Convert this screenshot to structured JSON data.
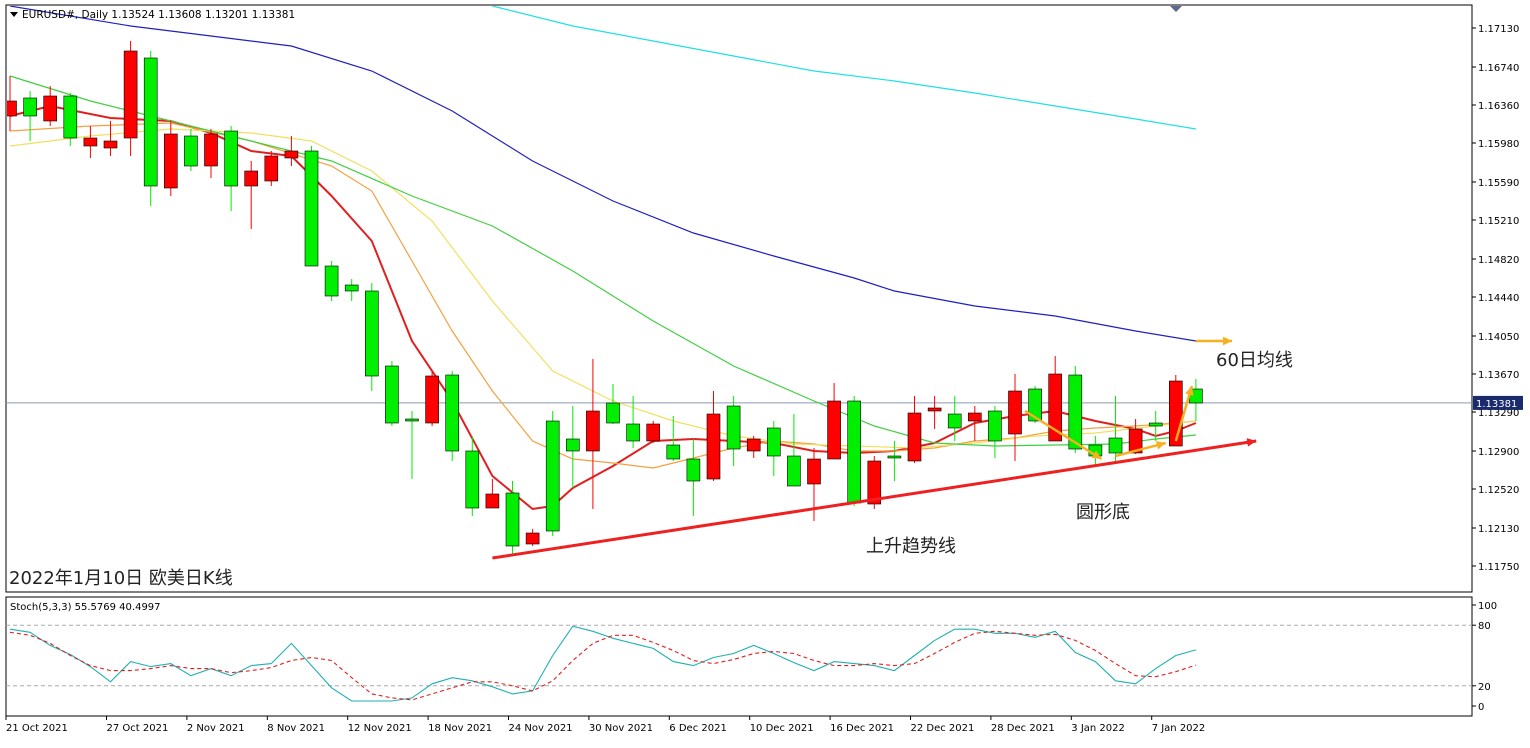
{
  "header": {
    "symbol_line": "EURUSD#, Daily  1.13524 1.13608 1.13201 1.13381"
  },
  "stoch_header": "Stoch(5,3,3) 55.5769 40.4997",
  "current_price_label": "1.13381",
  "annotations": {
    "caption": "2022年1月10日 欧美日K线",
    "ma60": "60日均线",
    "trendline": "上升趋势线",
    "rounding_bottom": "圆形底"
  },
  "colors": {
    "up_candle": "#00ee00",
    "down_candle": "#ff0000",
    "ma5": "#e02020",
    "ma10": "#f5a040",
    "ma20": "#f0e060",
    "ma30": "#40d040",
    "ma60": "#2020c0",
    "ma120": "#20e0e0",
    "stoch_main": "#20b0b0",
    "stoch_signal": "#e02020",
    "arrow_orange": "#f8b020",
    "trend_red": "#ee2020"
  },
  "chart_data": [
    {
      "type": "candlestick",
      "title": "EURUSD#, Daily",
      "ylim": [
        1.1155,
        1.1735
      ],
      "y_ticks": [
        "1.17130",
        "1.16740",
        "1.16360",
        "1.15980",
        "1.15590",
        "1.15210",
        "1.14820",
        "1.14440",
        "1.14050",
        "1.13670",
        "1.13290",
        "1.12900",
        "1.12520",
        "1.12130",
        "1.11750"
      ],
      "x_tick_labels": [
        "21 Oct 2021",
        "27 Oct 2021",
        "2 Nov 2021",
        "8 Nov 2021",
        "12 Nov 2021",
        "18 Nov 2021",
        "24 Nov 2021",
        "30 Nov 2021",
        "6 Dec 2021",
        "10 Dec 2021",
        "16 Dec 2021",
        "22 Dec 2021",
        "28 Dec 2021",
        "3 Jan 2022",
        "7 Jan 2022"
      ],
      "x_tick_bar_index": [
        0,
        5,
        9,
        13,
        17,
        21,
        25,
        29,
        33,
        37,
        41,
        45,
        49,
        53,
        57
      ],
      "current_price": 1.13381,
      "ohlc": [
        [
          1.164,
          1.1665,
          1.161,
          1.1625
        ],
        [
          1.1625,
          1.165,
          1.16,
          1.1643
        ],
        [
          1.1645,
          1.1655,
          1.1615,
          1.162
        ],
        [
          1.1603,
          1.1648,
          1.1595,
          1.1645
        ],
        [
          1.1603,
          1.1615,
          1.1583,
          1.1595
        ],
        [
          1.16,
          1.162,
          1.1585,
          1.1593
        ],
        [
          1.169,
          1.17,
          1.1585,
          1.1603
        ],
        [
          1.1555,
          1.169,
          1.1535,
          1.1683
        ],
        [
          1.1607,
          1.162,
          1.1545,
          1.1553
        ],
        [
          1.1575,
          1.1612,
          1.157,
          1.1605
        ],
        [
          1.1607,
          1.1612,
          1.1563,
          1.1575
        ],
        [
          1.1555,
          1.1615,
          1.153,
          1.161
        ],
        [
          1.157,
          1.158,
          1.1512,
          1.1555
        ],
        [
          1.1585,
          1.159,
          1.1555,
          1.156
        ],
        [
          1.159,
          1.1605,
          1.1575,
          1.1583
        ],
        [
          1.1475,
          1.1595,
          1.1475,
          1.159
        ],
        [
          1.1445,
          1.148,
          1.144,
          1.1475
        ],
        [
          1.145,
          1.1462,
          1.144,
          1.1456
        ],
        [
          1.1365,
          1.1458,
          1.135,
          1.145
        ],
        [
          1.1318,
          1.138,
          1.1315,
          1.1375
        ],
        [
          1.132,
          1.133,
          1.1262,
          1.1322
        ],
        [
          1.1365,
          1.137,
          1.1315,
          1.1318
        ],
        [
          1.129,
          1.137,
          1.128,
          1.1366
        ],
        [
          1.1233,
          1.1305,
          1.1225,
          1.129
        ],
        [
          1.1247,
          1.1262,
          1.1233,
          1.1233
        ],
        [
          1.1195,
          1.126,
          1.1185,
          1.1248
        ],
        [
          1.1208,
          1.1212,
          1.1195,
          1.1197
        ],
        [
          1.121,
          1.133,
          1.1205,
          1.132
        ],
        [
          1.129,
          1.1335,
          1.1253,
          1.1302
        ],
        [
          1.133,
          1.1382,
          1.1232,
          1.129
        ],
        [
          1.1318,
          1.1357,
          1.1317,
          1.1338
        ],
        [
          1.13,
          1.1345,
          1.1293,
          1.1317
        ],
        [
          1.1317,
          1.132,
          1.1298,
          1.13
        ],
        [
          1.1282,
          1.1325,
          1.128,
          1.1296
        ],
        [
          1.126,
          1.1302,
          1.1225,
          1.1282
        ],
        [
          1.1327,
          1.135,
          1.126,
          1.1262
        ],
        [
          1.1292,
          1.1345,
          1.1275,
          1.1335
        ],
        [
          1.1302,
          1.1305,
          1.1283,
          1.129
        ],
        [
          1.1285,
          1.132,
          1.1265,
          1.1313
        ],
        [
          1.1255,
          1.1327,
          1.1255,
          1.1285
        ],
        [
          1.1282,
          1.1293,
          1.122,
          1.1257
        ],
        [
          1.134,
          1.1358,
          1.1282,
          1.1282
        ],
        [
          1.1238,
          1.1345,
          1.1235,
          1.134
        ],
        [
          1.128,
          1.1285,
          1.1232,
          1.1237
        ],
        [
          1.1283,
          1.13,
          1.126,
          1.1285
        ],
        [
          1.1328,
          1.1345,
          1.1278,
          1.128
        ],
        [
          1.1333,
          1.1345,
          1.1312,
          1.133
        ],
        [
          1.1313,
          1.1345,
          1.13,
          1.1327
        ],
        [
          1.1328,
          1.1335,
          1.13,
          1.132
        ],
        [
          1.13,
          1.1335,
          1.1283,
          1.133
        ],
        [
          1.135,
          1.1367,
          1.128,
          1.1307
        ],
        [
          1.132,
          1.1355,
          1.1318,
          1.1352
        ],
        [
          1.1367,
          1.1385,
          1.13,
          1.13
        ],
        [
          1.1292,
          1.1375,
          1.1288,
          1.1366
        ],
        [
          1.1285,
          1.1305,
          1.1275,
          1.1296
        ],
        [
          1.1288,
          1.1345,
          1.128,
          1.1303
        ],
        [
          1.1312,
          1.1322,
          1.1287,
          1.1288
        ],
        [
          1.1315,
          1.133,
          1.13,
          1.1318
        ],
        [
          1.136,
          1.1366,
          1.1295,
          1.1295
        ],
        [
          1.1338,
          1.1362,
          1.132,
          1.1352
        ]
      ],
      "ma_lines": [
        {
          "key": "ma5",
          "from_bar": 0,
          "points": [
            [
              0,
              1.1625
            ],
            [
              2,
              1.1635
            ],
            [
              5,
              1.1623
            ],
            [
              8,
              1.162
            ],
            [
              10,
              1.1608
            ],
            [
              12,
              1.159
            ],
            [
              14,
              1.1585
            ],
            [
              16,
              1.1545
            ],
            [
              18,
              1.15
            ],
            [
              20,
              1.14
            ],
            [
              22,
              1.134
            ],
            [
              24,
              1.1265
            ],
            [
              26,
              1.1232
            ],
            [
              27,
              1.1235
            ],
            [
              28,
              1.1253
            ],
            [
              30,
              1.1275
            ],
            [
              32,
              1.13
            ],
            [
              34,
              1.1302
            ],
            [
              36,
              1.13
            ],
            [
              38,
              1.1298
            ],
            [
              40,
              1.129
            ],
            [
              42,
              1.1288
            ],
            [
              44,
              1.129
            ],
            [
              46,
              1.1298
            ],
            [
              48,
              1.1318
            ],
            [
              50,
              1.1325
            ],
            [
              52,
              1.133
            ],
            [
              54,
              1.132
            ],
            [
              56,
              1.1312
            ],
            [
              57,
              1.1305
            ],
            [
              58,
              1.131
            ],
            [
              59,
              1.1318
            ]
          ]
        },
        {
          "key": "ma10",
          "from_bar": 0,
          "points": [
            [
              0,
              1.161
            ],
            [
              4,
              1.1615
            ],
            [
              8,
              1.1618
            ],
            [
              12,
              1.16
            ],
            [
              16,
              1.1575
            ],
            [
              18,
              1.155
            ],
            [
              20,
              1.148
            ],
            [
              22,
              1.141
            ],
            [
              24,
              1.135
            ],
            [
              26,
              1.13
            ],
            [
              28,
              1.1282
            ],
            [
              30,
              1.1278
            ],
            [
              32,
              1.1273
            ],
            [
              34,
              1.1283
            ],
            [
              36,
              1.1293
            ],
            [
              38,
              1.13
            ],
            [
              40,
              1.1297
            ],
            [
              42,
              1.129
            ],
            [
              44,
              1.129
            ],
            [
              46,
              1.1293
            ],
            [
              48,
              1.13
            ],
            [
              50,
              1.1303
            ],
            [
              52,
              1.131
            ],
            [
              54,
              1.1313
            ],
            [
              56,
              1.1315
            ],
            [
              58,
              1.1318
            ],
            [
              59,
              1.132
            ]
          ]
        },
        {
          "key": "ma20",
          "from_bar": 0,
          "points": [
            [
              0,
              1.1595
            ],
            [
              4,
              1.1605
            ],
            [
              8,
              1.1612
            ],
            [
              12,
              1.1608
            ],
            [
              15,
              1.16
            ],
            [
              18,
              1.157
            ],
            [
              21,
              1.152
            ],
            [
              24,
              1.144
            ],
            [
              27,
              1.137
            ],
            [
              30,
              1.134
            ],
            [
              33,
              1.132
            ],
            [
              36,
              1.1305
            ],
            [
              39,
              1.1297
            ],
            [
              42,
              1.1295
            ],
            [
              45,
              1.1293
            ],
            [
              48,
              1.1298
            ],
            [
              51,
              1.1305
            ],
            [
              54,
              1.1308
            ],
            [
              57,
              1.1315
            ],
            [
              59,
              1.132
            ]
          ]
        },
        {
          "key": "ma30",
          "from_bar": 0,
          "points": [
            [
              0,
              1.1665
            ],
            [
              4,
              1.164
            ],
            [
              8,
              1.162
            ],
            [
              12,
              1.16
            ],
            [
              16,
              1.158
            ],
            [
              20,
              1.1545
            ],
            [
              24,
              1.1515
            ],
            [
              28,
              1.147
            ],
            [
              32,
              1.142
            ],
            [
              36,
              1.1375
            ],
            [
              40,
              1.134
            ],
            [
              43,
              1.1315
            ],
            [
              46,
              1.1298
            ],
            [
              49,
              1.1295
            ],
            [
              52,
              1.1296
            ],
            [
              55,
              1.1297
            ],
            [
              57,
              1.1302
            ],
            [
              59,
              1.1306
            ]
          ]
        },
        {
          "key": "ma60",
          "from_bar": 0,
          "points": [
            [
              0,
              1.1735
            ],
            [
              6,
              1.1715
            ],
            [
              10,
              1.1705
            ],
            [
              14,
              1.1695
            ],
            [
              18,
              1.167
            ],
            [
              22,
              1.163
            ],
            [
              26,
              1.158
            ],
            [
              30,
              1.154
            ],
            [
              34,
              1.1508
            ],
            [
              38,
              1.1485
            ],
            [
              42,
              1.1463
            ],
            [
              44,
              1.145
            ],
            [
              48,
              1.1435
            ],
            [
              52,
              1.1425
            ],
            [
              56,
              1.141
            ],
            [
              59,
              1.14
            ]
          ]
        },
        {
          "key": "ma120",
          "from_bar": 0,
          "points": [
            [
              24,
              1.1735
            ],
            [
              28,
              1.1715
            ],
            [
              32,
              1.17
            ],
            [
              36,
              1.1685
            ],
            [
              40,
              1.167
            ],
            [
              44,
              1.166
            ],
            [
              48,
              1.1648
            ],
            [
              52,
              1.1635
            ],
            [
              56,
              1.1622
            ],
            [
              59,
              1.1612
            ]
          ]
        }
      ],
      "trendline": {
        "from": [
          24,
          1.1183
        ],
        "to": [
          62,
          1.13
        ]
      },
      "rounding_arrows": [
        {
          "from": [
            50.5,
            1.133
          ],
          "to": [
            54.3,
            1.1282
          ]
        },
        {
          "from": [
            55.0,
            1.1285
          ],
          "to": [
            57.5,
            1.1298
          ]
        },
        {
          "from": [
            58.0,
            1.13
          ],
          "to": [
            58.8,
            1.1355
          ]
        }
      ],
      "ma60_arrow": {
        "from": [
          59.0,
          1.14
        ],
        "to": [
          60.8,
          1.14
        ]
      }
    },
    {
      "type": "line",
      "title": "Stoch(5,3,3)",
      "ylim": [
        0,
        100
      ],
      "y_ticks": [
        100,
        80,
        20,
        0
      ],
      "levels": [
        80,
        20
      ],
      "x_bars": [
        0,
        59
      ],
      "series": [
        {
          "name": "Stoch main",
          "values": [
            76,
            73,
            60,
            51,
            39,
            24,
            44,
            39,
            42,
            30,
            37,
            30,
            40,
            42,
            62,
            40,
            18,
            5,
            5,
            5,
            8,
            22,
            28,
            25,
            19,
            12,
            15,
            50,
            79,
            74,
            67,
            62,
            57,
            44,
            40,
            48,
            52,
            60,
            52,
            43,
            35,
            44,
            42,
            40,
            35,
            50,
            65,
            76,
            76,
            72,
            72,
            68,
            74,
            53,
            44,
            25,
            22,
            37,
            50,
            55.58
          ]
        },
        {
          "name": "Stoch signal",
          "values": [
            73,
            70,
            62,
            50,
            40,
            35,
            35,
            37,
            40,
            37,
            37,
            33,
            35,
            38,
            45,
            48,
            45,
            28,
            12,
            8,
            6,
            12,
            18,
            24,
            24,
            20,
            15,
            25,
            45,
            62,
            70,
            70,
            63,
            55,
            45,
            42,
            46,
            52,
            54,
            52,
            45,
            40,
            40,
            42,
            40,
            42,
            52,
            63,
            72,
            74,
            72,
            70,
            71,
            65,
            55,
            42,
            30,
            29,
            34,
            40.5
          ]
        }
      ]
    }
  ]
}
